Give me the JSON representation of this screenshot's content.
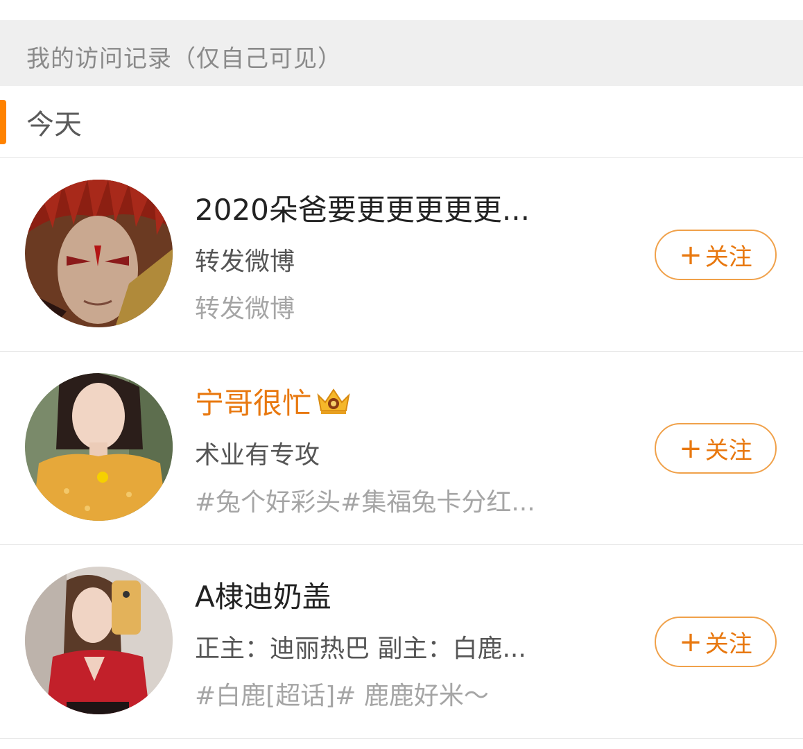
{
  "section": {
    "title": "我的访问记录（仅自己可见）"
  },
  "day": {
    "label": "今天"
  },
  "follow": {
    "plus": "+",
    "label": "关注"
  },
  "colors": {
    "accent": "#ff8200",
    "vip_name": "#e8780f",
    "button_border": "#f0a14a"
  },
  "visitors": [
    {
      "name": "2020朵爸要更更更更更...",
      "bio": "转发微博",
      "recent": "转发微博",
      "vip": false,
      "avatar_icon": "avatar-demon-warrior"
    },
    {
      "name": "宁哥很忙",
      "bio": "术业有专攻",
      "recent": "#兔个好彩头#集福兔卡分红...",
      "vip": true,
      "badge_icon": "crown-icon",
      "avatar_icon": "avatar-woman-yellow-top"
    },
    {
      "name": "A棣迪奶盖",
      "bio": "正主：迪丽热巴 副主：白鹿...",
      "recent": "#白鹿[超话]# 鹿鹿好米～",
      "vip": false,
      "avatar_icon": "avatar-woman-red-top"
    }
  ]
}
